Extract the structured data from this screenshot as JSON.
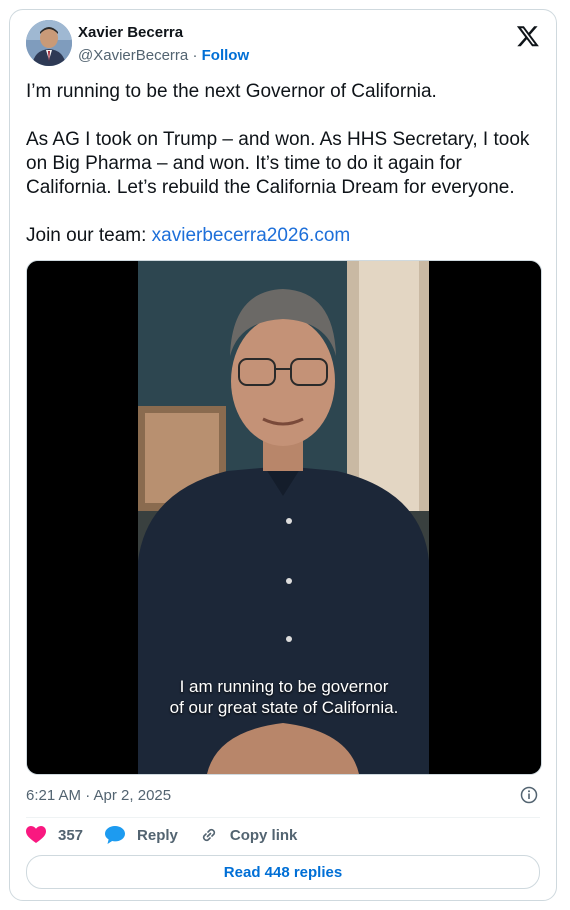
{
  "author": {
    "name": "Xavier Becerra",
    "handle": "@XavierBecerra",
    "separator": " · ",
    "follow_label": "Follow"
  },
  "tweet": {
    "line1": "I’m running to be the next Governor of California.",
    "line2": "As AG I took on Trump – and won. As HHS Secretary, I took on Big Pharma – and won. It’s time to do it again for California. Let’s rebuild the California Dream for everyone.",
    "join_label": "Join our team: ",
    "link_text": "xavierbecerra2026.com"
  },
  "video": {
    "caption_line1": "I am running to be governor",
    "caption_line2": "of our great state of California."
  },
  "timestamp": "6:21 AM · Apr 2, 2025",
  "actions": {
    "likes": "357",
    "reply_label": "Reply",
    "copy_label": "Copy link",
    "read_replies": "Read 448 replies"
  },
  "icons": [
    "x-logo-icon",
    "info-icon",
    "heart-icon",
    "reply-bubble-icon",
    "link-icon"
  ],
  "colors": {
    "accent": "#006fd6",
    "heart": "#f91880",
    "muted": "#536471"
  }
}
